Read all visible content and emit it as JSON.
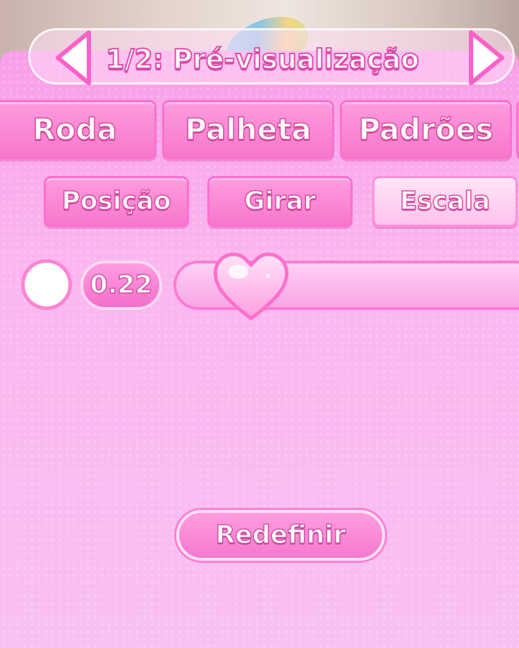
{
  "header": {
    "title": "1/2: Pré-visualização"
  },
  "main_tabs": [
    {
      "label": "Roda"
    },
    {
      "label": "Palheta"
    },
    {
      "label": "Padrões"
    }
  ],
  "sub_tabs": [
    {
      "label": "Posição"
    },
    {
      "label": "Girar"
    },
    {
      "label": "Escala",
      "selected": true
    }
  ],
  "scale": {
    "value": "0.22",
    "swatch_color": "#ffffff"
  },
  "reset": {
    "label": "Redefinir"
  },
  "icons": {
    "prev": "left-arrow-icon",
    "next": "right-arrow-icon",
    "thumb": "heart-icon"
  },
  "colors": {
    "accent": "#f777cc",
    "panel": "#f9b3ee",
    "stroke": "#e14cae"
  }
}
